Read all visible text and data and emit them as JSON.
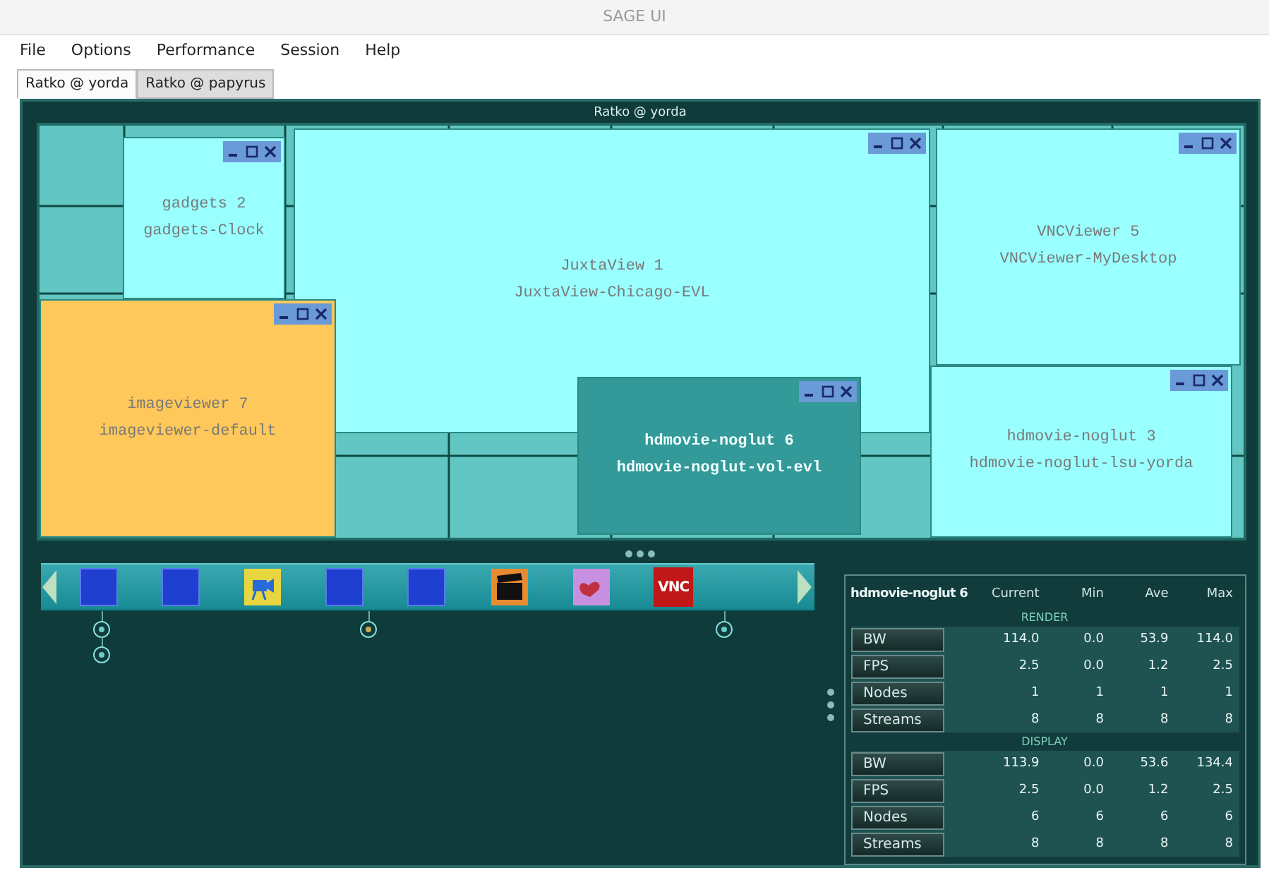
{
  "window": {
    "title": "SAGE UI"
  },
  "menu": [
    "File",
    "Options",
    "Performance",
    "Session",
    "Help"
  ],
  "tabs": [
    {
      "label": "Ratko @ yorda",
      "selected": true
    },
    {
      "label": "Ratko @ papyrus",
      "selected": false
    }
  ],
  "display": {
    "title": "Ratko @ yorda",
    "apps": [
      {
        "name": "JuxtaView 1",
        "config": "JuxtaView-Chicago-EVL",
        "color": "#99ffff"
      },
      {
        "name": "gadgets 2",
        "config": "gadgets-Clock",
        "color": "#99ffff"
      },
      {
        "name": "VNCViewer 5",
        "config": "VNCViewer-MyDesktop",
        "color": "#99ffff"
      },
      {
        "name": "hdmovie-noglut 3",
        "config": "hdmovie-noglut-lsu-yorda",
        "color": "#99ffff"
      },
      {
        "name": "imageviewer 7",
        "config": "imageviewer-default",
        "color": "#ffc85a"
      },
      {
        "name": "hdmovie-noglut 6",
        "config": "hdmovie-noglut-vol-evl",
        "color": "#339999"
      }
    ]
  },
  "taskbar": [
    {
      "kind": "blank",
      "pins": [
        {
          "color": "#66cccc"
        },
        {
          "color": "#66cccc"
        }
      ]
    },
    {
      "kind": "blank"
    },
    {
      "kind": "camera"
    },
    {
      "kind": "blank",
      "pins": [
        {
          "color": "#ccaa55"
        }
      ]
    },
    {
      "kind": "blank"
    },
    {
      "kind": "clapper"
    },
    {
      "kind": "heart"
    },
    {
      "kind": "vnc",
      "label": "VNC",
      "pins": [
        {
          "color": "#66cccc"
        }
      ]
    }
  ],
  "stats": {
    "title": "hdmovie-noglut 6",
    "columns": [
      "Current",
      "Min",
      "Ave",
      "Max"
    ],
    "sections": [
      {
        "title": "RENDER",
        "rows": [
          {
            "label": "BW",
            "values": [
              "114.0",
              "0.0",
              "53.9",
              "114.0"
            ]
          },
          {
            "label": "FPS",
            "values": [
              "2.5",
              "0.0",
              "1.2",
              "2.5"
            ]
          },
          {
            "label": "Nodes",
            "values": [
              "1",
              "1",
              "1",
              "1"
            ]
          },
          {
            "label": "Streams",
            "values": [
              "8",
              "8",
              "8",
              "8"
            ]
          }
        ]
      },
      {
        "title": "DISPLAY",
        "rows": [
          {
            "label": "BW",
            "values": [
              "113.9",
              "0.0",
              "53.6",
              "134.4"
            ]
          },
          {
            "label": "FPS",
            "values": [
              "2.5",
              "0.0",
              "1.2",
              "2.5"
            ]
          },
          {
            "label": "Nodes",
            "values": [
              "6",
              "6",
              "6",
              "6"
            ]
          },
          {
            "label": "Streams",
            "values": [
              "8",
              "8",
              "8",
              "8"
            ]
          }
        ]
      }
    ]
  }
}
